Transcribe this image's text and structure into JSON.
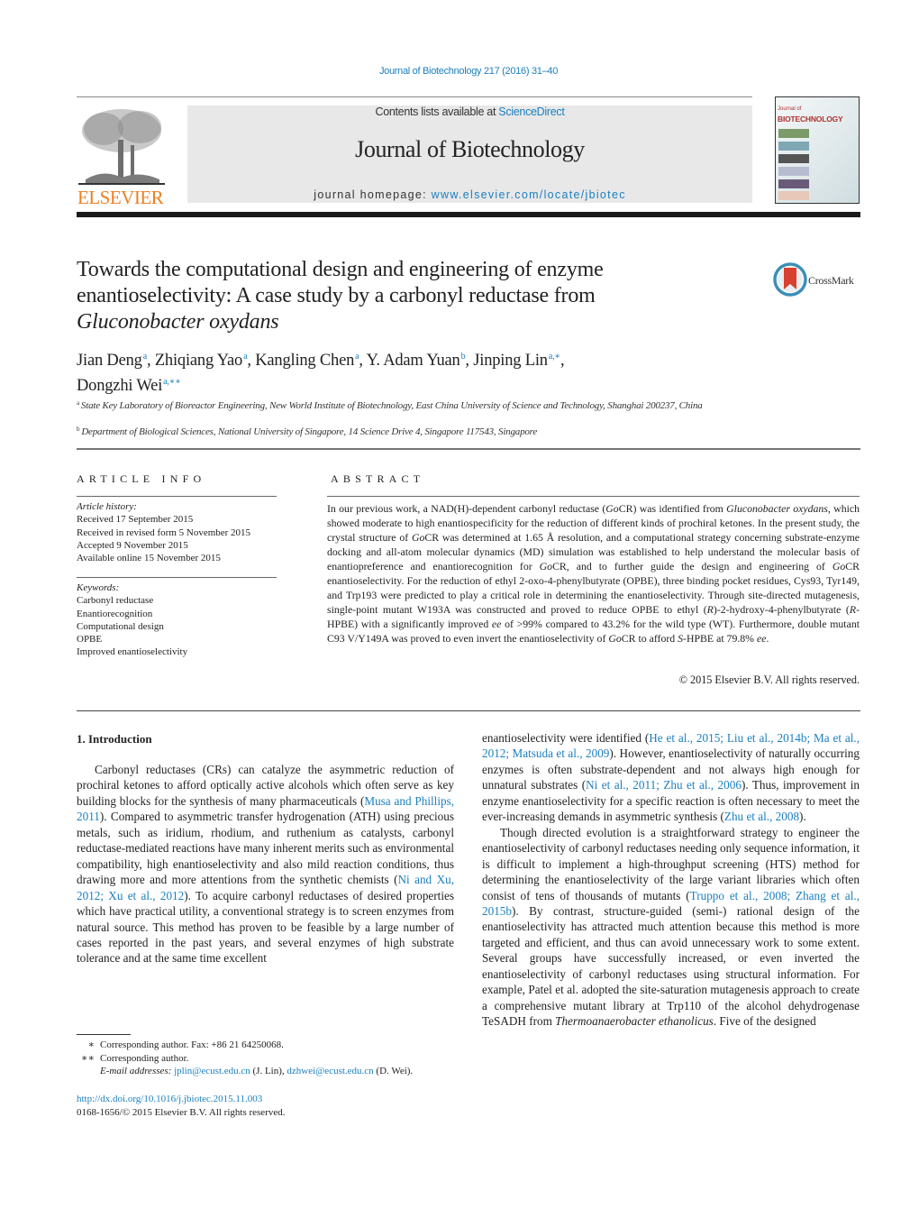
{
  "header": {
    "journal_ref": "Journal of Biotechnology 217 (2016) 31–40",
    "publisher_logo_word": "ELSEVIER",
    "contents_prefix": "Contents lists available at ",
    "contents_link": "ScienceDirect",
    "journal_title": "Journal of Biotechnology",
    "homepage_prefix": "journal homepage: ",
    "homepage_link": "www.elsevier.com/locate/jbiotec",
    "cover": {
      "line1": "Journal of",
      "line2": "BIOTECHNOLOGY"
    },
    "colors": {
      "link": "#1b7fbf",
      "elsevier_orange": "#ee7f22",
      "masthead_bg": "#e8e8e8"
    }
  },
  "article": {
    "title_line1": "Towards the computational design and engineering of enzyme",
    "title_line2": "enantioselectivity: A case study by a carbonyl reductase from",
    "title_line3_italic": "Gluconobacter oxydans",
    "crossmark_label": "CrossMark",
    "authors": [
      {
        "name": "Jian Deng",
        "sup": "a",
        "sep": ", "
      },
      {
        "name": "Zhiqiang Yao",
        "sup": "a",
        "sep": ", "
      },
      {
        "name": "Kangling Chen",
        "sup": "a",
        "sep": ", "
      },
      {
        "name": "Y. Adam Yuan",
        "sup": "b",
        "sep": ", "
      },
      {
        "name": "Jinping Lin",
        "sup": "a,∗",
        "sep": ","
      },
      {
        "name": "Dongzhi Wei",
        "sup": "a,∗∗",
        "sep": ""
      }
    ],
    "affiliations": [
      {
        "mark": "a",
        "text": "State Key Laboratory of Bioreactor Engineering, New World Institute of Biotechnology, East China University of Science and Technology, Shanghai 200237, China"
      },
      {
        "mark": "b",
        "text": "Department of Biological Sciences, National University of Singapore, 14 Science Drive 4, Singapore 117543, Singapore"
      }
    ]
  },
  "article_info": {
    "heading": "ARTICLE INFO",
    "history_label": "Article history:",
    "history": [
      "Received 17 September 2015",
      "Received in revised form 5 November 2015",
      "Accepted 9 November 2015",
      "Available online 15 November 2015"
    ],
    "keywords_label": "Keywords:",
    "keywords": [
      "Carbonyl reductase",
      "Enantiorecognition",
      "Computational design",
      "OPBE",
      "Improved enantioselectivity"
    ]
  },
  "abstract": {
    "heading": "ABSTRACT",
    "segments": [
      {
        "t": "In our previous work, a NAD(H)-dependent carbonyl reductase ("
      },
      {
        "t": "Go",
        "i": true
      },
      {
        "t": "CR) was identified from "
      },
      {
        "t": "Gluconobacter oxydans",
        "i": true
      },
      {
        "t": ", which showed moderate to high enantiospecificity for the reduction of different kinds of prochiral ketones. In the present study, the crystal structure of "
      },
      {
        "t": "Go",
        "i": true
      },
      {
        "t": "CR was determined at 1.65 Å resolution, and a computational strategy concerning substrate-enzyme docking and all-atom molecular dynamics (MD) simulation was established to help understand the molecular basis of enantiopreference and enantiorecognition for "
      },
      {
        "t": "Go",
        "i": true
      },
      {
        "t": "CR, and to further guide the design and engineering of "
      },
      {
        "t": "Go",
        "i": true
      },
      {
        "t": "CR enantioselectivity. For the reduction of ethyl 2-oxo-4-phenylbutyrate (OPBE), three binding pocket residues, Cys93, Tyr149, and Trp193 were predicted to play a critical role in determining the enantioselectivity. Through site-directed mutagenesis, single-point mutant W193A was constructed and proved to reduce OPBE to ethyl ("
      },
      {
        "t": "R",
        "i": true
      },
      {
        "t": ")-2-hydroxy-4-phenylbutyrate ("
      },
      {
        "t": "R",
        "i": true
      },
      {
        "t": "-HPBE) with a significantly improved "
      },
      {
        "t": "ee",
        "i": true
      },
      {
        "t": " of >99% compared to 43.2% for the wild type (WT). Furthermore, double mutant C93 V/Y149A was proved to even invert the enantioselectivity of "
      },
      {
        "t": "Go",
        "i": true
      },
      {
        "t": "CR to afford "
      },
      {
        "t": "S",
        "i": true
      },
      {
        "t": "-HPBE at 79.8% "
      },
      {
        "t": "ee",
        "i": true
      },
      {
        "t": "."
      }
    ],
    "copyright": "© 2015 Elsevier B.V. All rights reserved."
  },
  "body": {
    "section_heading": "1.  Introduction",
    "left_paragraphs": [
      [
        {
          "t": "Carbonyl reductases (CRs) can catalyze the asymmetric reduction of prochiral ketones to afford optically active alcohols which often serve as key building blocks for the synthesis of many pharmaceuticals ("
        },
        {
          "t": "Musa and Phillips, 2011",
          "link": true
        },
        {
          "t": "). Compared to asymmetric transfer hydrogenation (ATH) using precious metals, such as iridium, rhodium, and ruthenium as catalysts, carbonyl reductase-mediated reactions have many inherent merits such as environmental compatibility, high enantioselectivity and also mild reaction conditions, thus drawing more and more attentions from the synthetic chemists ("
        },
        {
          "t": "Ni and Xu, 2012; Xu et al., 2012",
          "link": true
        },
        {
          "t": "). To acquire carbonyl reductases of desired properties which have practical utility, a conventional strategy is to screen enzymes from natural source. This method has proven to be feasible by a large number of cases reported in the past years, and several enzymes of high substrate tolerance and at the same time excellent"
        }
      ]
    ],
    "right_paragraphs": [
      [
        {
          "t": "enantioselectivity were identified ("
        },
        {
          "t": "He et al., 2015; Liu et al., 2014b; Ma et al., 2012; Matsuda et al., 2009",
          "link": true
        },
        {
          "t": "). However, enantioselectivity of naturally occurring enzymes is often substrate-dependent and not always high enough for unnatural substrates ("
        },
        {
          "t": "Ni et al., 2011; Zhu et al., 2006",
          "link": true
        },
        {
          "t": "). Thus, improvement in enzyme enantioselectivity for a specific reaction is often necessary to meet the ever-increasing demands in asymmetric synthesis ("
        },
        {
          "t": "Zhu et al., 2008",
          "link": true
        },
        {
          "t": ")."
        }
      ],
      [
        {
          "t": "Though directed evolution is a straightforward strategy to engineer the enantioselectivity of carbonyl reductases needing only sequence information, it is difficult to implement a high-throughput screening (HTS) method for determining the enantioselectivity of the large variant libraries which often consist of tens of thousands of mutants ("
        },
        {
          "t": "Truppo et al., 2008; Zhang et al., 2015b",
          "link": true
        },
        {
          "t": "). By contrast, structure-guided (semi-) rational design of the enantioselectivity has attracted much attention because this method is more targeted and efficient, and thus can avoid unnecessary work to some extent. Several groups have successfully increased, or even inverted the enantioselectivity of carbonyl reductases using structural information. For example, Patel et al. adopted the site-saturation mutagenesis approach to create a comprehensive mutant library at Trp110 of the alcohol dehydrogenase TeSADH from "
        },
        {
          "t": "Thermoanaerobacter ethanolicus",
          "i": true
        },
        {
          "t": ". Five of the designed"
        }
      ]
    ]
  },
  "footnotes": {
    "fn1_mark": "∗",
    "fn1_text": "Corresponding author. Fax: +86 21 64250068.",
    "fn2_mark": "∗∗",
    "fn2_text": "Corresponding author.",
    "email_label": "E-mail addresses: ",
    "email1": "jplin@ecust.edu.cn",
    "email1_owner": " (J. Lin), ",
    "email2": "dzhwei@ecust.edu.cn",
    "email2_owner": " (D. Wei).",
    "doi": "http://dx.doi.org/10.1016/j.jbiotec.2015.11.003",
    "issn_copyright": "0168-1656/© 2015 Elsevier B.V. All rights reserved."
  }
}
